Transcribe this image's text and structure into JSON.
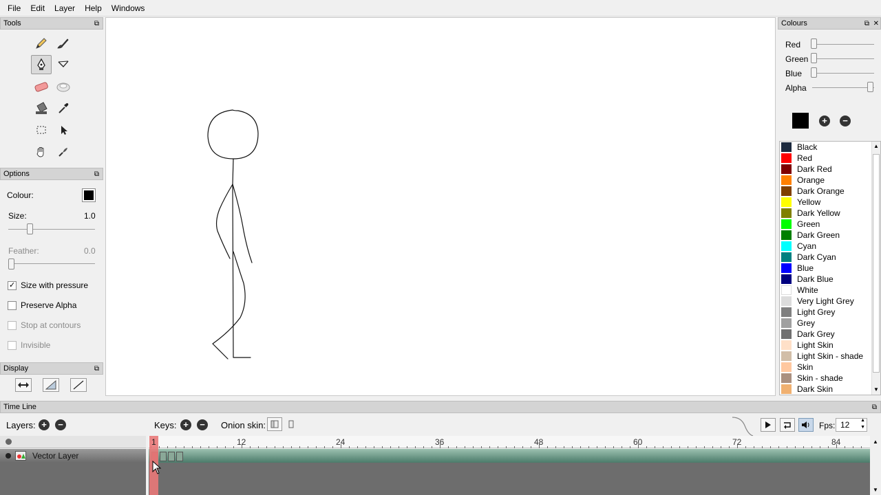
{
  "menu": [
    "File",
    "Edit",
    "Layer",
    "Help",
    "Windows"
  ],
  "tools_panel": {
    "title": "Tools",
    "float_icon": "⧉"
  },
  "options_panel": {
    "title": "Options",
    "colour_label": "Colour:",
    "colour_value": "#000000",
    "size_label": "Size:",
    "size_value": "1.0",
    "feather_label": "Feather:",
    "feather_value": "0.0",
    "checkboxes": [
      {
        "label": "Size with pressure",
        "checked": true,
        "enabled": true
      },
      {
        "label": "Preserve Alpha",
        "checked": false,
        "enabled": true
      },
      {
        "label": "Stop at contours",
        "checked": false,
        "enabled": false
      },
      {
        "label": "Invisible",
        "checked": false,
        "enabled": false
      }
    ]
  },
  "display_panel": {
    "title": "Display"
  },
  "colours_panel": {
    "title": "Colours",
    "sliders": [
      {
        "label": "Red",
        "value": 0
      },
      {
        "label": "Green",
        "value": 0
      },
      {
        "label": "Blue",
        "value": 0
      },
      {
        "label": "Alpha",
        "value": 1
      }
    ],
    "current_colour": "#000000",
    "palette": [
      {
        "name": "Black",
        "color": "#1c2a3e"
      },
      {
        "name": "Red",
        "color": "#ff0000"
      },
      {
        "name": "Dark Red",
        "color": "#800000"
      },
      {
        "name": "Orange",
        "color": "#ff8000"
      },
      {
        "name": "Dark Orange",
        "color": "#804000"
      },
      {
        "name": "Yellow",
        "color": "#ffff00"
      },
      {
        "name": "Dark Yellow",
        "color": "#808000"
      },
      {
        "name": "Green",
        "color": "#00ff00"
      },
      {
        "name": "Dark Green",
        "color": "#008000"
      },
      {
        "name": "Cyan",
        "color": "#00ffff"
      },
      {
        "name": "Dark Cyan",
        "color": "#008080"
      },
      {
        "name": "Blue",
        "color": "#0000ff"
      },
      {
        "name": "Dark Blue",
        "color": "#000080"
      },
      {
        "name": "White",
        "color": "#ffffff"
      },
      {
        "name": "Very Light Grey",
        "color": "#dcdcdc"
      },
      {
        "name": "Light Grey",
        "color": "#808080"
      },
      {
        "name": "Grey",
        "color": "#a0a0a0"
      },
      {
        "name": "Dark Grey",
        "color": "#707070"
      },
      {
        "name": "Light Skin",
        "color": "#ffe0c8"
      },
      {
        "name": "Light Skin - shade",
        "color": "#d2bea8"
      },
      {
        "name": "Skin",
        "color": "#ffc8a0"
      },
      {
        "name": "Skin - shade",
        "color": "#aa9080"
      },
      {
        "name": "Dark Skin",
        "color": "#f0b070"
      }
    ]
  },
  "timeline": {
    "title": "Time Line",
    "layers_label": "Layers:",
    "keys_label": "Keys:",
    "onion_label": "Onion skin:",
    "fps_label": "Fps:",
    "fps_value": "12",
    "layer_name": "Vector Layer",
    "frame_ticks": [
      1,
      12,
      24,
      36,
      48,
      60,
      72,
      84
    ],
    "current_frame": "1"
  }
}
